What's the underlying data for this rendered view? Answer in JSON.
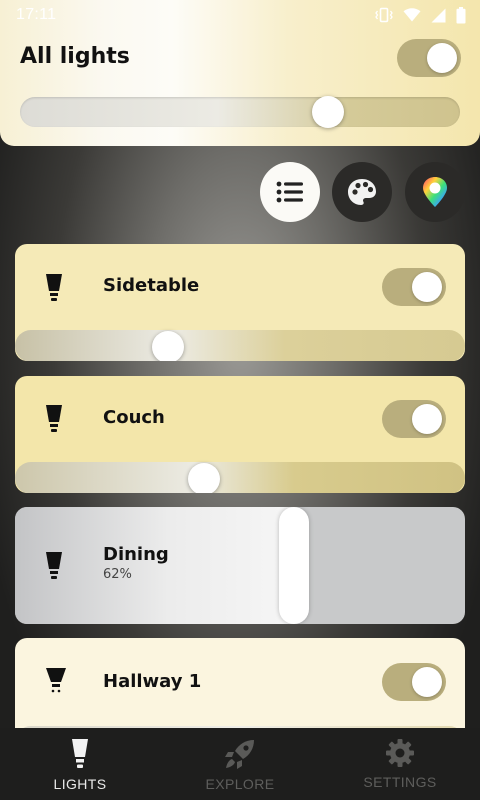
{
  "status_bar": {
    "time": "17:11"
  },
  "all_lights": {
    "title": "All lights",
    "on": true,
    "brightness": 0.7
  },
  "view_buttons": [
    {
      "name": "list-view",
      "icon": "list-icon",
      "selected": true
    },
    {
      "name": "scenes",
      "icon": "palette-icon",
      "selected": false
    },
    {
      "name": "color-picker",
      "icon": "color-drop-icon",
      "selected": false
    }
  ],
  "lights": [
    {
      "name": "Sidetable",
      "on": true,
      "brightness": 0.34
    },
    {
      "name": "Couch",
      "on": true,
      "brightness": 0.42
    },
    {
      "name": "Dining",
      "status": "62%",
      "brightness": 0.62
    },
    {
      "name": "Hallway 1",
      "on": true
    }
  ],
  "nav": [
    {
      "label": "LIGHTS",
      "icon": "bulb-icon",
      "active": true
    },
    {
      "label": "EXPLORE",
      "icon": "rocket-icon",
      "active": false
    },
    {
      "label": "SETTINGS",
      "icon": "gear-icon",
      "active": false
    }
  ],
  "colors": {
    "warm_card": "#f5eab7",
    "toggle_on": "#b9ae7d",
    "dining_card": "#c9cacb",
    "nav_bg": "#1e1e1d"
  }
}
